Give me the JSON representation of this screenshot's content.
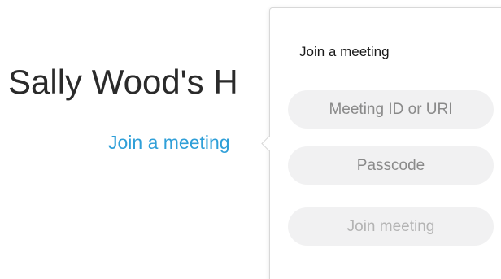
{
  "main": {
    "room_title": "Sally Wood's H",
    "join_link_label": "Join a meeting"
  },
  "popover": {
    "heading": "Join a meeting",
    "meeting_id_placeholder": "Meeting ID or URI",
    "meeting_id_value": "",
    "passcode_placeholder": "Passcode",
    "passcode_value": "",
    "join_button_label": "Join meeting",
    "join_button_enabled": false
  },
  "colors": {
    "link": "#2f9fd8",
    "title_text": "#2a2a2a",
    "field_background": "#f1f1f2",
    "placeholder_text": "#8a8a8a",
    "disabled_button_text": "#b4b4b4"
  }
}
